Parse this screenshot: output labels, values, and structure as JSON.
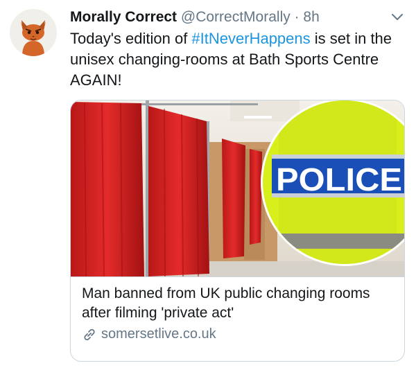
{
  "tweet": {
    "author_name": "Morally Correct",
    "handle": "@CorrectMorally",
    "separator": "·",
    "time": "8h",
    "text_before": "Today's edition of ",
    "hashtag": "#ItNeverHappens",
    "text_after": " is set in the unisex changing-rooms at Bath Sports Centre AGAIN!"
  },
  "card": {
    "badge_text": "POLICE",
    "title": "Man banned from UK public changing rooms after filming 'private act'",
    "domain": "somersetlive.co.uk"
  },
  "colors": {
    "hashtag": "#1b95e0",
    "secondary_text": "#657786",
    "border": "#ccd6dd",
    "curtain_red": "#d62424",
    "hi_vis": "#d8ef1c",
    "police_blue": "#1a4fb8"
  },
  "icons": {
    "avatar": "cat-avatar-icon",
    "menu": "chevron-down-icon",
    "link": "link-icon"
  }
}
